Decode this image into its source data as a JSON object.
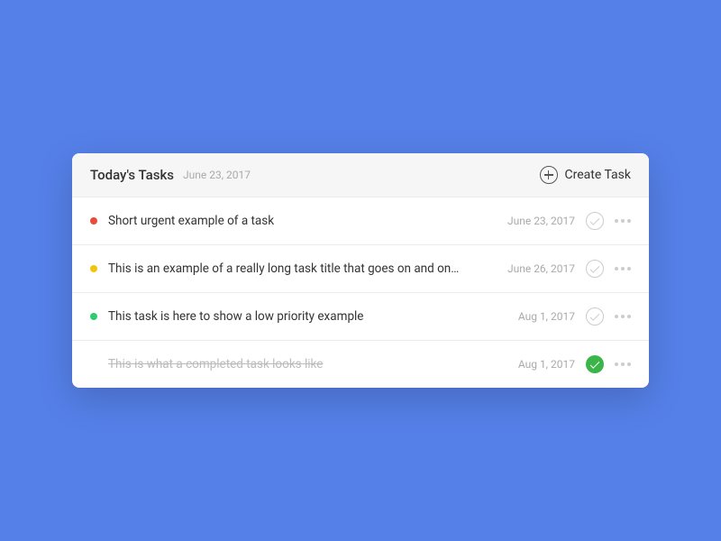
{
  "colors": {
    "priority_high": "#e74c3c",
    "priority_medium": "#f1c40f",
    "priority_low": "#2ecc71"
  },
  "header": {
    "title": "Today's Tasks",
    "date": "June 23, 2017",
    "create_label": "Create Task"
  },
  "tasks": [
    {
      "priority": "high",
      "title": "Short urgent example of a task",
      "date": "June 23, 2017",
      "completed": false
    },
    {
      "priority": "medium",
      "title": "This is an example of a really long task title that goes on and on…",
      "date": "June 26, 2017",
      "completed": false
    },
    {
      "priority": "low",
      "title": "This task is here to show a low priority example",
      "date": "Aug 1, 2017",
      "completed": false
    },
    {
      "priority": null,
      "title": "This is what a completed task looks like",
      "date": "Aug 1, 2017",
      "completed": true
    }
  ]
}
